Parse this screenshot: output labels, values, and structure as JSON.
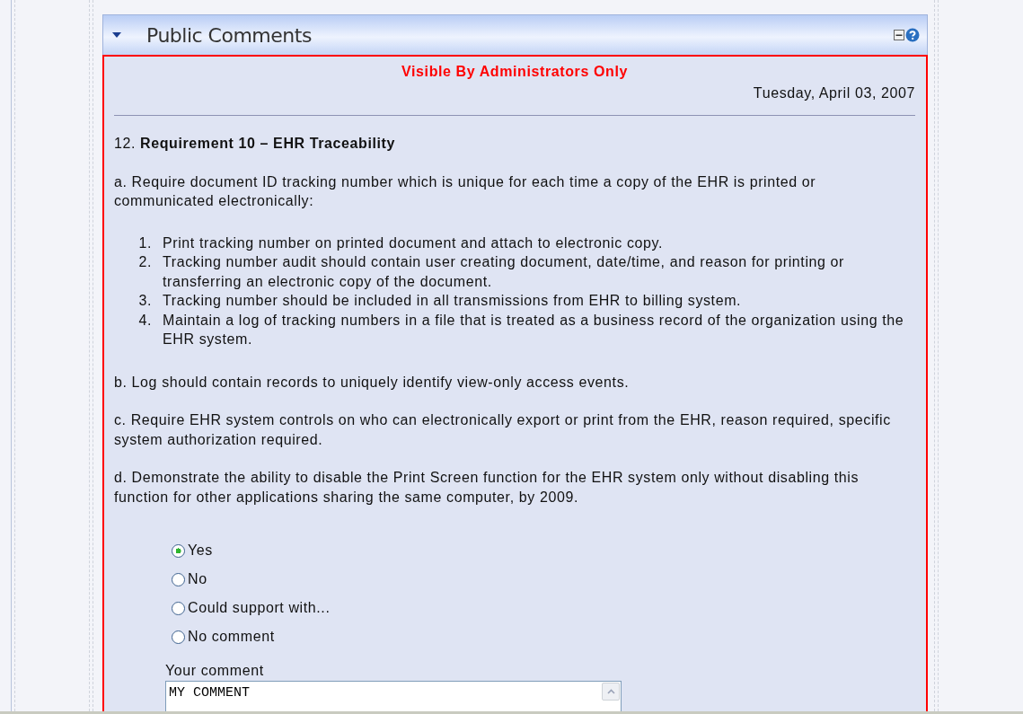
{
  "panel": {
    "title": "Public Comments",
    "expanded": true,
    "notice": "Visible By Administrators Only",
    "date": "Tuesday, April 03, 2007",
    "question": {
      "number": "12.",
      "title": "Requirement 10 – EHR Traceability"
    },
    "sections": [
      {
        "kind": "paragraph",
        "text": "a. Require document ID tracking number which is unique for each time a copy of the EHR is printed or communicated electronically:"
      },
      {
        "kind": "list",
        "items": [
          {
            "number": "1.",
            "text": "Print tracking number on printed document and attach to electronic copy."
          },
          {
            "number": "2.",
            "text": "Tracking number audit should contain user creating document, date/time, and reason for printing or transferring an electronic copy of the document."
          },
          {
            "number": "3.",
            "text": "Tracking number should be included in all transmissions from EHR to billing system."
          },
          {
            "number": "4.",
            "text": "Maintain a log of tracking numbers in a file that is treated as a business record of the organization using the EHR system."
          }
        ]
      },
      {
        "kind": "paragraph",
        "text": "b. Log should contain records to uniquely identify view-only access events."
      },
      {
        "kind": "paragraph",
        "text": "c. Require EHR system controls on who can electronically export or print from the EHR, reason required, specific system authorization required."
      },
      {
        "kind": "paragraph",
        "text": "d. Demonstrate the ability to disable the Print Screen function for the EHR system only without disabling this function for other applications sharing the same computer, by 2009."
      }
    ],
    "options": [
      {
        "label": "Yes",
        "selected": true
      },
      {
        "label": "No",
        "selected": false
      },
      {
        "label": "Could support with...",
        "selected": false
      },
      {
        "label": "No comment",
        "selected": false
      }
    ],
    "comment": {
      "label": "Your comment",
      "value": "MY COMMENT"
    }
  }
}
